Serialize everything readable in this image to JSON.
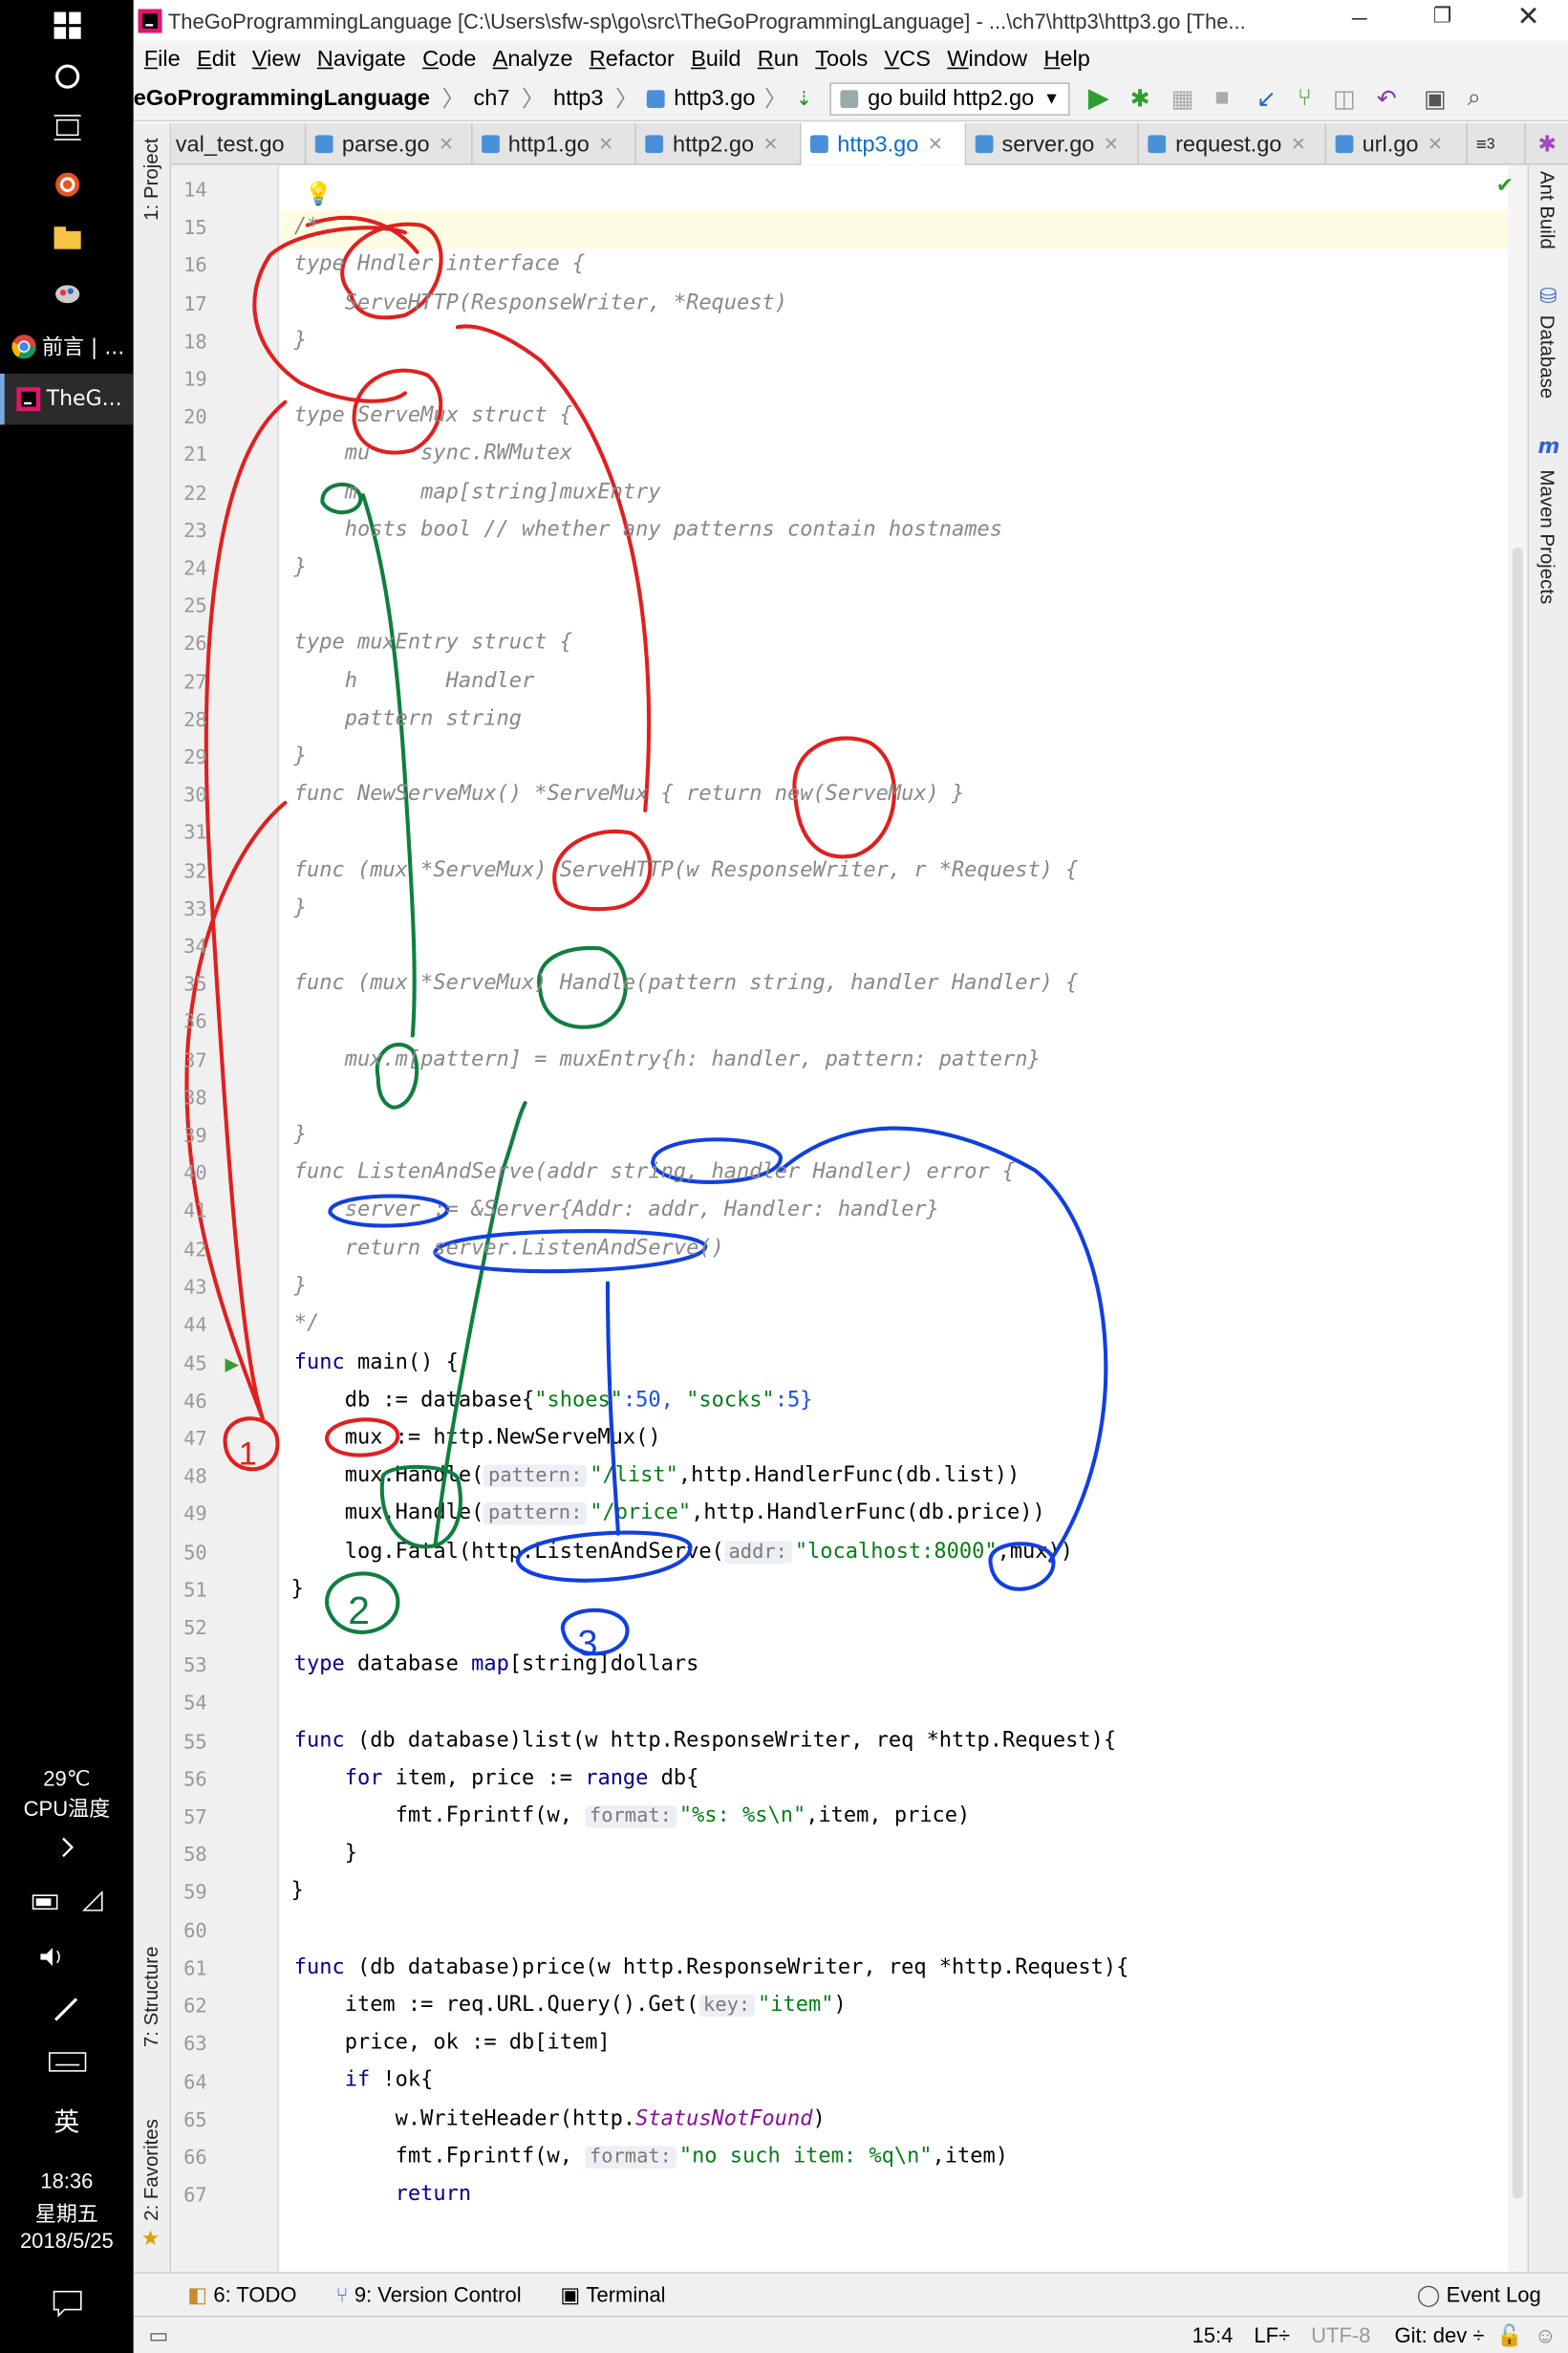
{
  "taskbar": {
    "apps": [
      {
        "label": "前言 | ...",
        "icon": "chrome-icon"
      },
      {
        "label": "TheG...",
        "icon": "intellij-icon"
      }
    ],
    "temperature": "29℃",
    "cpu_label": "CPU温度",
    "ime": "英",
    "time": "18:36",
    "weekday": "星期五",
    "date": "2018/5/25"
  },
  "window": {
    "title": "TheGoProgrammingLanguage [C:\\Users\\sfw-sp\\go\\src\\TheGoProgrammingLanguage] - ...\\ch7\\http3\\http3.go [The..."
  },
  "menu": [
    "File",
    "Edit",
    "View",
    "Navigate",
    "Code",
    "Analyze",
    "Refactor",
    "Build",
    "Run",
    "Tools",
    "VCS",
    "Window",
    "Help"
  ],
  "breadcrumb": {
    "project": "eGoProgrammingLanguage",
    "items": [
      "ch7",
      "http3",
      "http3.go"
    ],
    "run_config": "go build http2.go"
  },
  "tabs": [
    {
      "label": "val_test.go",
      "active": false
    },
    {
      "label": "parse.go",
      "active": false
    },
    {
      "label": "http1.go",
      "active": false
    },
    {
      "label": "http2.go",
      "active": false
    },
    {
      "label": "http3.go",
      "active": true
    },
    {
      "label": "server.go",
      "active": false
    },
    {
      "label": "request.go",
      "active": false
    },
    {
      "label": "url.go",
      "active": false
    }
  ],
  "tab_overflow": "3",
  "left_tool_windows": {
    "project": "1: Project",
    "structure": "7: Structure",
    "favorites": "2: Favorites"
  },
  "right_tool_windows": {
    "ant": "Ant Build",
    "database": "Database",
    "maven": "Maven Projects"
  },
  "code_lines": [
    {
      "n": "14",
      "text": ""
    },
    {
      "n": "15",
      "text": "/*"
    },
    {
      "n": "16",
      "text": "type Hndler interface {"
    },
    {
      "n": "17",
      "text": "    ServeHTTP(ResponseWriter, *Request)"
    },
    {
      "n": "18",
      "text": "}"
    },
    {
      "n": "19",
      "text": ""
    },
    {
      "n": "20",
      "text": "type ServeMux struct {"
    },
    {
      "n": "21",
      "text": "    mu    sync.RWMutex"
    },
    {
      "n": "22",
      "text": "    m     map[string]muxEntry"
    },
    {
      "n": "23",
      "text": "    hosts bool // whether any patterns contain hostnames"
    },
    {
      "n": "24",
      "text": "}"
    },
    {
      "n": "25",
      "text": ""
    },
    {
      "n": "26",
      "text": "type muxEntry struct {"
    },
    {
      "n": "27",
      "text": "    h       Handler"
    },
    {
      "n": "28",
      "text": "    pattern string"
    },
    {
      "n": "29",
      "text": "}"
    },
    {
      "n": "30",
      "text": "func NewServeMux() *ServeMux { return new(ServeMux) }"
    },
    {
      "n": "31",
      "text": ""
    },
    {
      "n": "32",
      "text": "func (mux *ServeMux) ServeHTTP(w ResponseWriter, r *Request) {"
    },
    {
      "n": "33",
      "text": "}"
    },
    {
      "n": "34",
      "text": ""
    },
    {
      "n": "35",
      "text": "func (mux *ServeMux) Handle(pattern string, handler Handler) {"
    },
    {
      "n": "36",
      "text": ""
    },
    {
      "n": "37",
      "text": "    mux.m[pattern] = muxEntry{h: handler, pattern: pattern}"
    },
    {
      "n": "38",
      "text": ""
    },
    {
      "n": "39",
      "text": "}"
    },
    {
      "n": "40",
      "text": "func ListenAndServe(addr string, handler Handler) error {"
    },
    {
      "n": "41",
      "text": "    server := &Server{Addr: addr, Handler: handler}"
    },
    {
      "n": "42",
      "text": "    return server.ListenAndServe()"
    },
    {
      "n": "43",
      "text": "}"
    },
    {
      "n": "44",
      "text": "*/"
    }
  ],
  "code_active": {
    "l45_kw": "func",
    "l45_rest": " main() {",
    "l46_a": "    db := database{",
    "l46_s1": "\"shoes\"",
    "l46_b": ":50, ",
    "l46_s2": "\"socks\"",
    "l46_c": ":5}",
    "l47": "    mux := http.NewServeMux()",
    "l48_a": "    mux.Handle(",
    "l48_hint": "pattern:",
    "l48_s": "\"/list\"",
    "l48_b": ",http.HandlerFunc(db.list))",
    "l49_a": "    mux.Handle(",
    "l49_hint": "pattern:",
    "l49_s": "\"/price\"",
    "l49_b": ",http.HandlerFunc(db.price))",
    "l50_a": "    log.Fatal(http.ListenAndServe(",
    "l50_hint": "addr:",
    "l50_s": "\"localhost:8000\"",
    "l50_b": ",mux))",
    "l51": "}",
    "l53_kw": "type",
    "l53_a": " database ",
    "l53_kw2": "map",
    "l53_b": "[string]dollars",
    "l55_kw": "func",
    "l55_rest": " (db database)list(w http.ResponseWriter, req *http.Request){",
    "l56_a": "    ",
    "l56_kw": "for",
    "l56_b": " item, price := ",
    "l56_kw2": "range",
    "l56_c": " db{",
    "l57_a": "        fmt.Fprintf(w, ",
    "l57_hint": "format:",
    "l57_s": "\"%s: %s\\n\"",
    "l57_b": ",item, price)",
    "l58": "    }",
    "l59": "}",
    "l61_kw": "func",
    "l61_rest": " (db database)price(w http.ResponseWriter, req *http.Request){",
    "l62_a": "    item := req.URL.Query().Get(",
    "l62_hint": "key:",
    "l62_s": "\"item\"",
    "l62_b": ")",
    "l63": "    price, ok := db[item]",
    "l64_a": "    ",
    "l64_kw": "if",
    "l64_b": " !ok{",
    "l65_a": "        w.WriteHeader(http.",
    "l65_i": "StatusNotFound",
    "l65_b": ")",
    "l66_a": "        fmt.Fprintf(w, ",
    "l66_hint": "format:",
    "l66_s": "\"no such item: %q\\n\"",
    "l66_b": ",item)",
    "l67_kw": "        return"
  },
  "line_numbers_active": [
    "45",
    "46",
    "47",
    "48",
    "49",
    "50",
    "51",
    "52",
    "53",
    "54",
    "55",
    "56",
    "57",
    "58",
    "59",
    "60",
    "61",
    "62",
    "63",
    "64",
    "65",
    "66",
    "67"
  ],
  "annotations": {
    "one": "1",
    "two": "2",
    "three": "3"
  },
  "bottom_tools": {
    "todo": "6: TODO",
    "vcs": "9: Version Control",
    "terminal": "Terminal",
    "event_log": "Event Log"
  },
  "status": {
    "position": "15:4",
    "line_sep": "LF÷",
    "encoding": "UTF-8",
    "git": "Git: dev ÷"
  },
  "colors": {
    "red": "#e0201f",
    "green": "#0f7f3f",
    "blue": "#1040e0"
  }
}
